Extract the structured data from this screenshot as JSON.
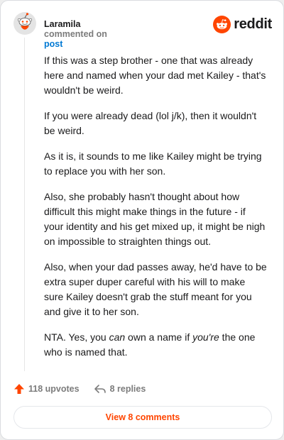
{
  "header": {
    "username": "Laramila",
    "action_text": "commented on",
    "target": "post",
    "brand": "reddit"
  },
  "comment": {
    "paragraphs": [
      "If this was a step brother - one that was already here and named when your dad met Kailey - that's wouldn't be weird.",
      "If you were already dead (lol j/k), then it wouldn't be weird.",
      "As it is, it sounds to me like Kailey might be trying to replace you with her son.",
      "Also, she probably hasn't thought about how difficult this might make things in the future - if your identity and his get mixed up, it might be nigh on impossible to straighten things out.",
      "Also, when your dad passes away, he'd have to be extra super duper careful with his will to make sure Kailey doesn't grab the stuff meant for you and give it to her son."
    ],
    "last_paragraph": {
      "part1": "NTA. Yes, you ",
      "em1": "can",
      "part2": " own a name if ",
      "em2": "you're",
      "part3": " the one who is named that."
    }
  },
  "actions": {
    "upvotes": "118 upvotes",
    "replies": "8 replies"
  },
  "view_button": "View 8 comments",
  "colors": {
    "accent": "#ff4500",
    "link": "#0079d3",
    "muted": "#7c7c7c"
  }
}
